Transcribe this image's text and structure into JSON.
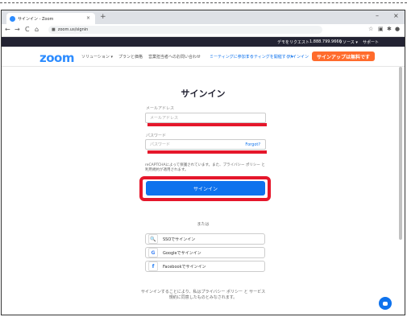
{
  "browser": {
    "tab_title": "サインイン - Zoom",
    "tab_close": "×",
    "new_tab": "+",
    "minimize": "–",
    "close": "×",
    "back": "←",
    "forward": "→",
    "reload": "C",
    "home": "⌂",
    "url": "zoom.us/signin"
  },
  "topbar": {
    "items": [
      "デモをリクエスト",
      "1.888.799.9666",
      "リソース ▾",
      "サポート"
    ]
  },
  "navbar": {
    "logo": "zoom",
    "items": [
      "ソリューション ▾",
      "プランと価格",
      "営業担当者へのお問い合わせ",
      "ミーティングに参加する",
      "ミーティングを開催する ▾",
      "サインイン"
    ],
    "signup_label": "サインアップは無料です"
  },
  "form": {
    "title": "サインイン",
    "email_label": "メールアドレス",
    "email_placeholder": "メールアドレス",
    "password_label": "パスワード",
    "password_placeholder": "パスワード",
    "forgot_label": "Forgot?",
    "notice": "reCAPTCHAによって保護されています。また、プライバシー ポリシー と 利用規約が適用されます。",
    "signin_label": "サインイン"
  },
  "alt": {
    "or_label": "または",
    "sso_label": "SSOでサインイン",
    "google_label": "Googleでサインイン",
    "facebook_label": "Facebookでサインイン"
  },
  "terms": {
    "line1_prefix": "サインインすることにより、私はプライバシー ポリシー と サービス",
    "line2": "規約に同意したものとみなされます。"
  },
  "colors": {
    "brand": "#2d8cff",
    "primary": "#0e72ed",
    "signup": "#ff6b2c",
    "highlight": "#e5172b"
  }
}
